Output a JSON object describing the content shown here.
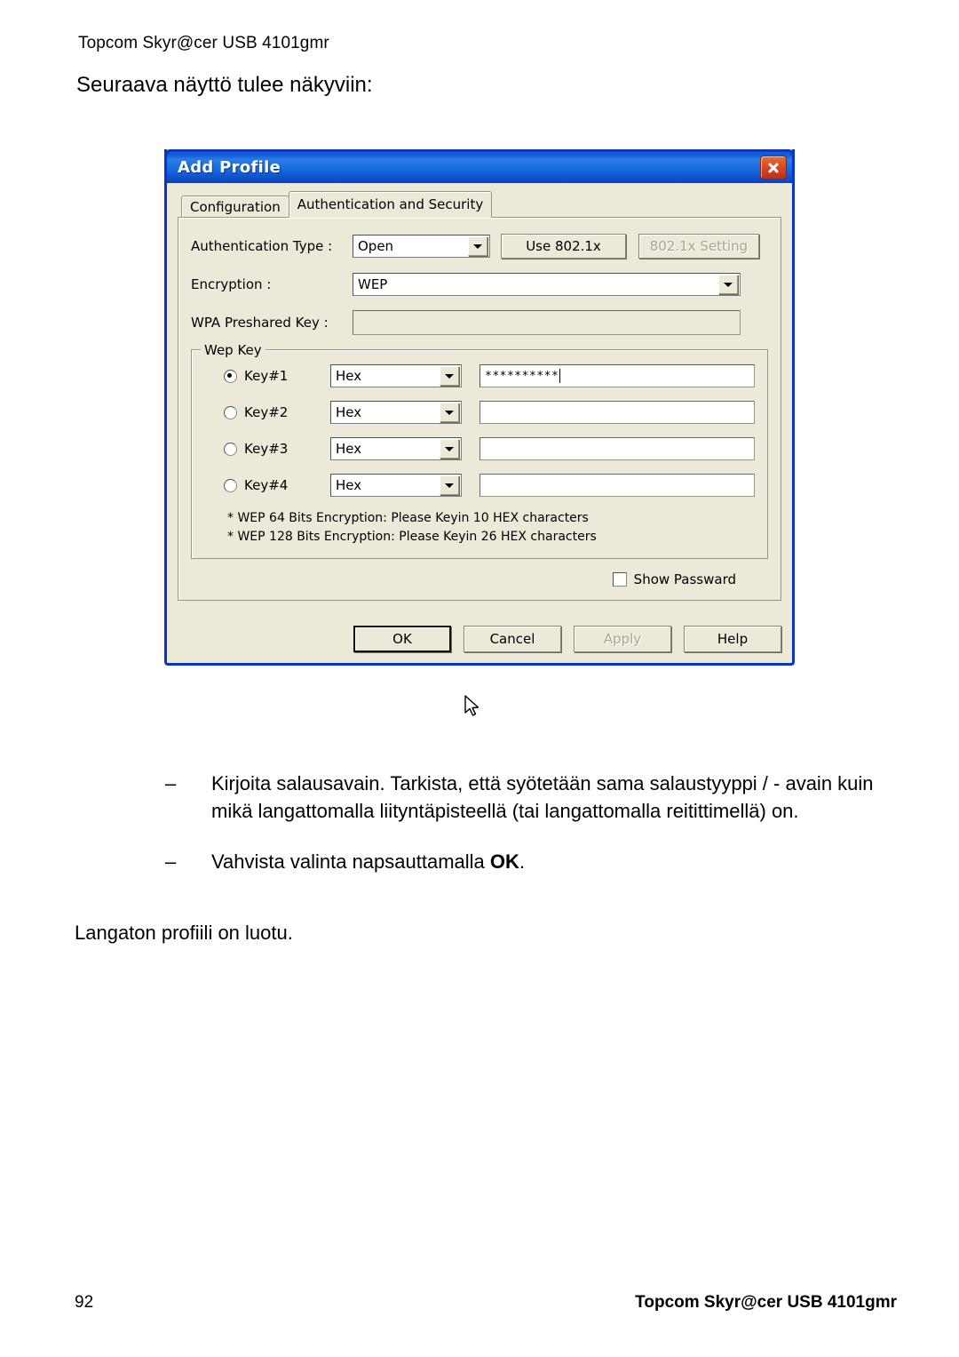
{
  "document": {
    "header": "Topcom Skyr@cer USB 4101gmr",
    "intro": "Seuraava näyttö tulee näkyviin:",
    "bullets": [
      {
        "dash": "–",
        "text": "Kirjoita salausavain. Tarkista, että syötetään sama salaustyyppi / - avain kuin mikä langattomalla liityntäpisteellä (tai langattomalla reitittimellä) on."
      },
      {
        "dash": "–",
        "text_before": "Vahvista valinta napsauttamalla ",
        "text_bold": "OK",
        "text_after": "."
      }
    ],
    "closing": "Langaton profiili on luotu.",
    "footer": {
      "page_number": "92",
      "title": "Topcom Skyr@cer USB 4101gmr"
    }
  },
  "dialog": {
    "title": "Add Profile",
    "close_icon": "close-icon",
    "tabs": [
      {
        "label": "Configuration",
        "active": false
      },
      {
        "label": "Authentication and Security",
        "active": true
      }
    ],
    "fields": {
      "auth_type_label": "Authentication Type :",
      "auth_type_value": "Open",
      "use_8021x_button": "Use 802.1x",
      "setting_8021x_button": "802.1x Setting",
      "encryption_label": "Encryption :",
      "encryption_value": "WEP",
      "wpa_key_label": "WPA Preshared Key :",
      "wpa_key_value": ""
    },
    "wep_group": {
      "title": "Wep Key",
      "keys": [
        {
          "label": "Key#1",
          "selected": true,
          "format": "Hex",
          "value": "**********"
        },
        {
          "label": "Key#2",
          "selected": false,
          "format": "Hex",
          "value": ""
        },
        {
          "label": "Key#3",
          "selected": false,
          "format": "Hex",
          "value": ""
        },
        {
          "label": "Key#4",
          "selected": false,
          "format": "Hex",
          "value": ""
        }
      ],
      "hint_line_1": "* WEP 64 Bits Encryption:   Please Keyin 10 HEX characters",
      "hint_line_2": "* WEP 128 Bits Encryption:   Please Keyin 26 HEX characters",
      "show_password_label": "Show Passward",
      "show_password_checked": false
    },
    "buttons": {
      "ok": "OK",
      "cancel": "Cancel",
      "apply": "Apply",
      "help": "Help"
    },
    "colors": {
      "titlebar_blue": "#1b6ee2",
      "dialog_face": "#ece9d8",
      "close_red": "#d94b28",
      "border_blue": "#0a36c8"
    }
  }
}
